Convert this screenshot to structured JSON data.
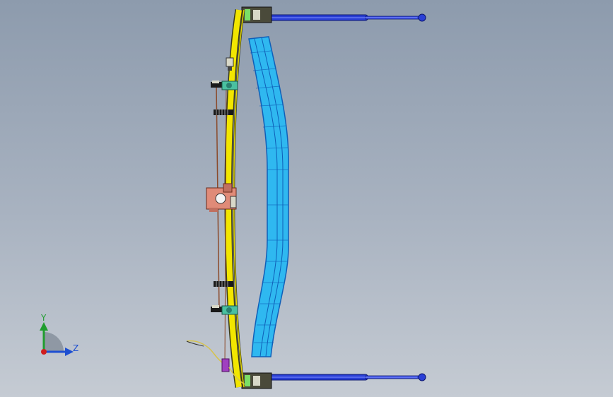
{
  "viewport": {
    "background_top": "#8d9bad",
    "background_bottom": "#c5cbd3"
  },
  "model": {
    "frame_color": "#f2e600",
    "frame_outline": "#3a3a1c",
    "beam_color": "#2fb8f0",
    "beam_dark": "#0f5fb8",
    "rod_color": "#2a3fd6",
    "bracket_color": "#e08b78",
    "bolt_color": "#1a1a1a",
    "connector_color": "#a040c0",
    "cable_color": "#d7c34a"
  },
  "triad": {
    "y_label": "Y",
    "z_label": "Z",
    "y_color": "#1f9d2e",
    "z_color": "#1d4fd1",
    "origin_color": "#d01d1d",
    "icon": "coordinate-triad-icon"
  }
}
